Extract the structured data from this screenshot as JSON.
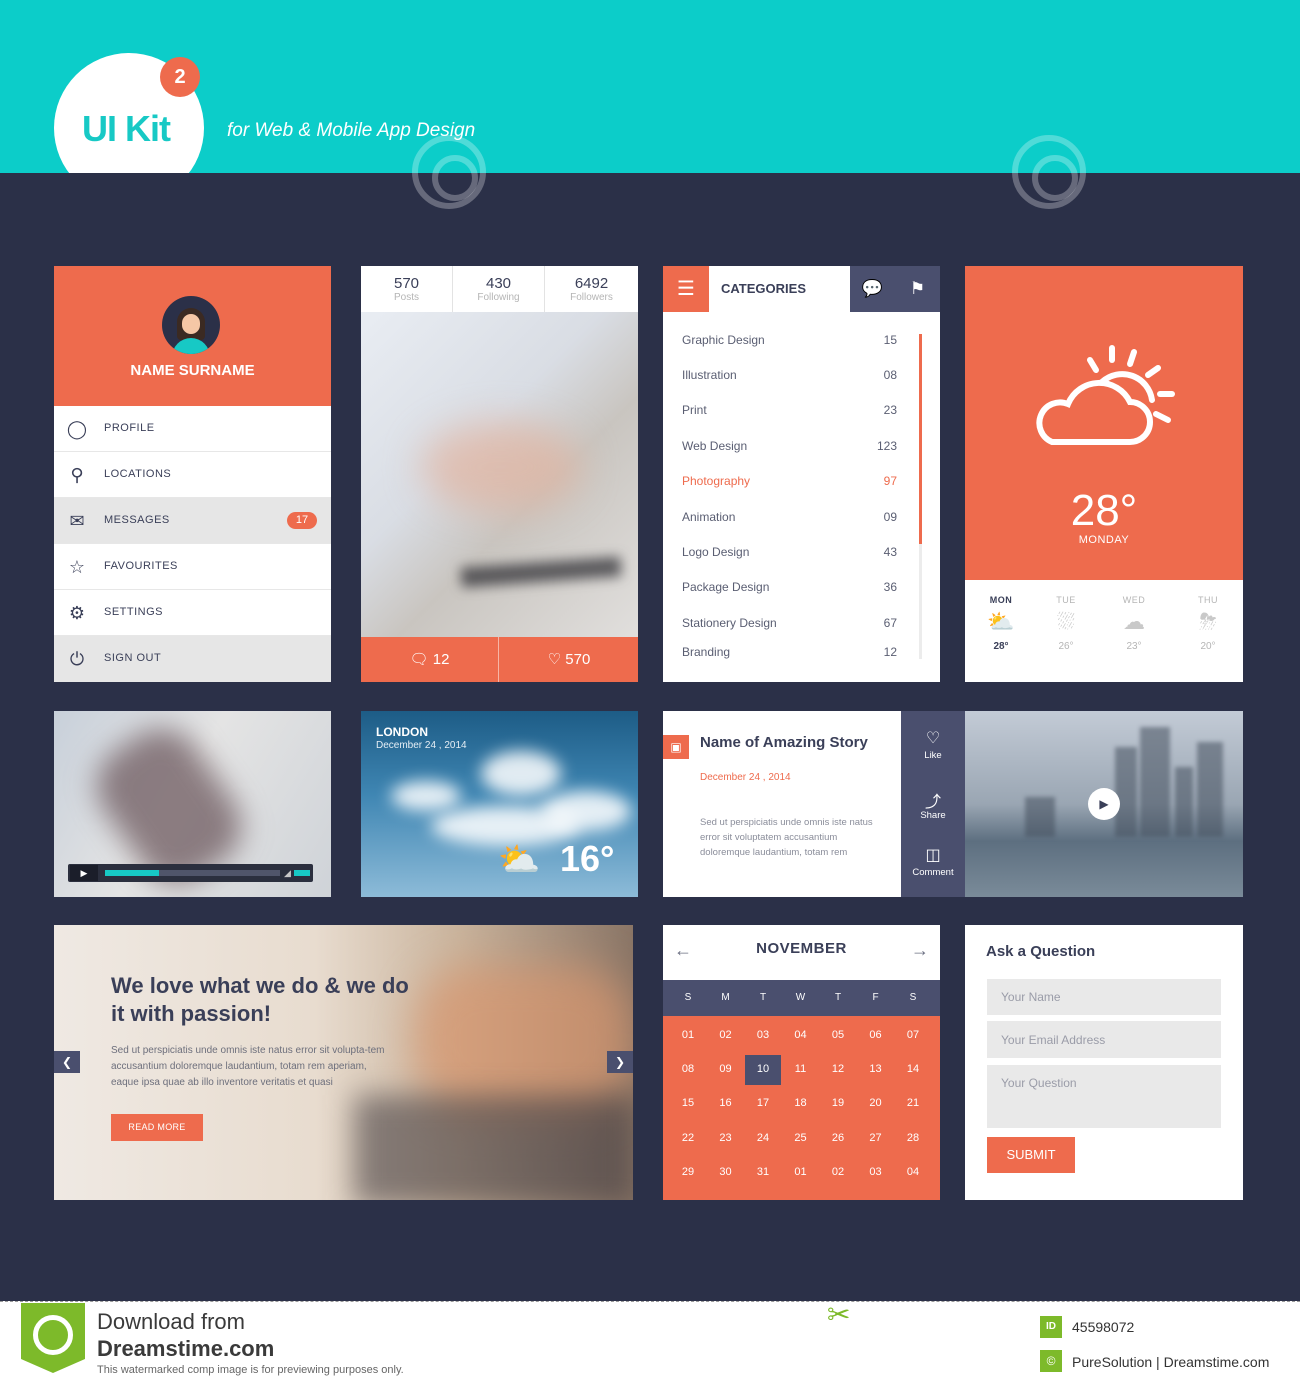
{
  "header": {
    "logo": "UI Kit",
    "badge": "2",
    "tagline": "for Web & Mobile App Design"
  },
  "colors": {
    "accent": "#ee6b4d",
    "teal": "#0ccdc9",
    "navy": "#2b3048",
    "slate": "#4a4f6e"
  },
  "profile": {
    "name": "NAME SURNAME",
    "menu": [
      {
        "label": "PROFILE",
        "icon": "user-icon"
      },
      {
        "label": "LOCATIONS",
        "icon": "pin-icon"
      },
      {
        "label": "MESSAGES",
        "icon": "envelope-icon",
        "badge": "17"
      },
      {
        "label": "FAVOURITES",
        "icon": "star-icon"
      },
      {
        "label": "SETTINGS",
        "icon": "gear-icon"
      },
      {
        "label": "SIGN OUT",
        "icon": "power-icon"
      }
    ]
  },
  "stats": {
    "items": [
      {
        "value": "570",
        "label": "Posts"
      },
      {
        "value": "430",
        "label": "Following"
      },
      {
        "value": "6492",
        "label": "Followers"
      }
    ],
    "comments": "12",
    "likes": "570"
  },
  "categories": {
    "title": "CATEGORIES",
    "items": [
      {
        "name": "Graphic Design",
        "count": "15"
      },
      {
        "name": "Illustration",
        "count": "08"
      },
      {
        "name": "Print",
        "count": "23"
      },
      {
        "name": "Web Design",
        "count": "123"
      },
      {
        "name": "Photography",
        "count": "97"
      },
      {
        "name": "Animation",
        "count": "09"
      },
      {
        "name": "Logo Design",
        "count": "43"
      },
      {
        "name": "Package Design",
        "count": "36"
      },
      {
        "name": "Stationery Design",
        "count": "67"
      },
      {
        "name": "Branding",
        "count": "12"
      }
    ]
  },
  "weather": {
    "temp": "28°",
    "day": "MONDAY",
    "forecast": [
      {
        "day": "MON",
        "temp": "28°"
      },
      {
        "day": "TUE",
        "temp": "26°"
      },
      {
        "day": "WED",
        "temp": "23°"
      },
      {
        "day": "THU",
        "temp": "20°"
      }
    ]
  },
  "video": {
    "progress": 0.31,
    "volume": 1.0
  },
  "london": {
    "city": "LONDON",
    "date": "December 24 , 2014",
    "temp": "16°"
  },
  "story": {
    "title": "Name of Amazing Story",
    "date": "December 24 , 2014",
    "text": "Sed ut perspiciatis unde omnis iste natus error sit voluptatem accusantium doloremque laudantium, totam rem",
    "actions": [
      "Like",
      "Share",
      "Comment"
    ]
  },
  "hero": {
    "title": "We love what we do & we do it with passion!",
    "text": "Sed ut perspiciatis unde omnis iste natus error sit volupta-tem accusantium doloremque laudantium, totam rem aperiam, eaque ipsa quae ab illo inventore veritatis et quasi",
    "button": "READ MORE"
  },
  "calendar": {
    "month": "NOVEMBER",
    "dow": [
      "S",
      "M",
      "T",
      "W",
      "T",
      "F",
      "S"
    ],
    "weeks": [
      [
        "01",
        "02",
        "03",
        "04",
        "05",
        "06",
        "07"
      ],
      [
        "08",
        "09",
        "10",
        "11",
        "12",
        "13",
        "14"
      ],
      [
        "15",
        "16",
        "17",
        "18",
        "19",
        "20",
        "21"
      ],
      [
        "22",
        "23",
        "24",
        "25",
        "26",
        "27",
        "28"
      ],
      [
        "29",
        "30",
        "31",
        "01",
        "02",
        "03",
        "04"
      ]
    ],
    "selected": "10"
  },
  "form": {
    "title": "Ask a Question",
    "name_placeholder": "Your Name",
    "email_placeholder": "Your Email Address",
    "question_placeholder": "Your Question",
    "submit": "SUBMIT"
  },
  "footer": {
    "line1": "Download from",
    "line2": "Dreamstime.com",
    "line3": "This watermarked comp image is for previewing purposes only.",
    "id": "45598072",
    "credit": "PureSolution | Dreamstime.com",
    "id_badge": "ID",
    "credit_badge": "©"
  }
}
